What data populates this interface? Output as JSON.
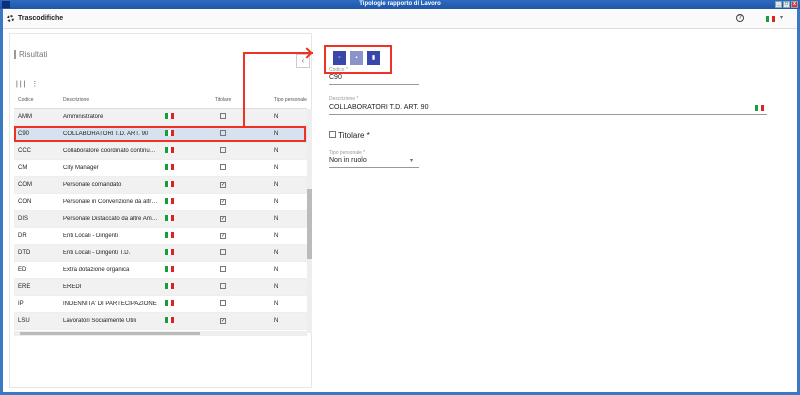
{
  "window": {
    "title": "Tipologie rapporto di Lavoro"
  },
  "appbar": {
    "title": "Trascodifiche",
    "help": "?"
  },
  "left": {
    "panel_title": "Risultati",
    "columns": [
      "Codice",
      "Descrizione",
      "Titolare",
      "Tipo personale"
    ],
    "rows": [
      {
        "code": "AMM",
        "desc": "Amministratore",
        "titolare": false,
        "tipo": "N"
      },
      {
        "code": "C90",
        "desc": "COLLABORATORI T.D. ART. 90",
        "titolare": false,
        "tipo": "N"
      },
      {
        "code": "CCC",
        "desc": "Collaboratore coordinato continua…",
        "titolare": false,
        "tipo": "N"
      },
      {
        "code": "CM",
        "desc": "City Manager",
        "titolare": false,
        "tipo": "N"
      },
      {
        "code": "COM",
        "desc": "Personale comandato",
        "titolare": true,
        "tipo": "N"
      },
      {
        "code": "CON",
        "desc": "Personale in Convenzione da altre …",
        "titolare": true,
        "tipo": "N"
      },
      {
        "code": "DIS",
        "desc": "Personale Distaccato da altre Am…",
        "titolare": true,
        "tipo": "N"
      },
      {
        "code": "DR",
        "desc": "Enti Locali - Dirigenti",
        "titolare": true,
        "tipo": "N"
      },
      {
        "code": "DTD",
        "desc": "Enti Locali - Dirigenti T.D.",
        "titolare": false,
        "tipo": "N"
      },
      {
        "code": "ED",
        "desc": "Extra dotazione organica",
        "titolare": false,
        "tipo": "N"
      },
      {
        "code": "ERE",
        "desc": "EREDI",
        "titolare": false,
        "tipo": "N"
      },
      {
        "code": "IP",
        "desc": "INDENNITA' DI PARTECIPAZIONE",
        "titolare": false,
        "tipo": "N"
      },
      {
        "code": "LSU",
        "desc": "Lavoratori Socialmente Utili",
        "titolare": true,
        "tipo": "N"
      }
    ]
  },
  "detail": {
    "codice_label": "Codice *",
    "codice_value": "C90",
    "descrizione_label": "Descrizione *",
    "descrizione_value": "COLLABORATORI T.D. ART. 90",
    "titolare_label": "Titolare *",
    "tipo_label": "Tipo personale *",
    "tipo_value": "Non in ruolo"
  }
}
